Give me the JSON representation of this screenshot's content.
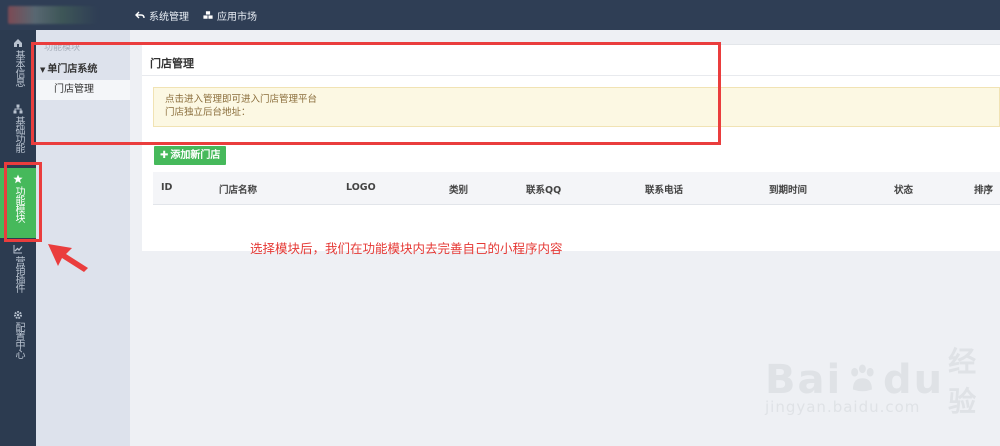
{
  "topnav": {
    "items": [
      {
        "label": "系统管理",
        "icon": "back-arrow-icon"
      },
      {
        "label": "应用市场",
        "icon": "cubes-icon"
      }
    ]
  },
  "leftnav": {
    "items": [
      {
        "label": "基本信息",
        "icon": "home-icon"
      },
      {
        "label": "基础功能",
        "icon": "sitemap-icon"
      },
      {
        "label": "功能模块",
        "icon": "star-icon",
        "active": true
      },
      {
        "label": "营销插件",
        "icon": "chart-line-icon"
      },
      {
        "label": "配置中心",
        "icon": "gear-icon"
      }
    ]
  },
  "sidenav": {
    "faded_label": "功能模块",
    "group_label": "单门店系统",
    "item_label": "门店管理"
  },
  "panel": {
    "title": "门店管理",
    "alert_line1": "点击进入管理即可进入门店管理平台",
    "alert_line2": "门店独立后台地址：",
    "add_button": "添加新门店",
    "columns": [
      "ID",
      "门店名称",
      "LOGO",
      "类别",
      "联系QQ",
      "联系电话",
      "到期时间",
      "状态",
      "排序"
    ]
  },
  "annotation": "选择模块后，我们在功能模块内去完善自己的小程序内容",
  "watermark": {
    "brand": "Bai",
    "brand2": "du",
    "suffix": "经验",
    "url": "jingyan.baidu.com"
  },
  "colors": {
    "accent": "#46b95b",
    "annotation": "#e53935",
    "topbar": "#2f3e55"
  }
}
